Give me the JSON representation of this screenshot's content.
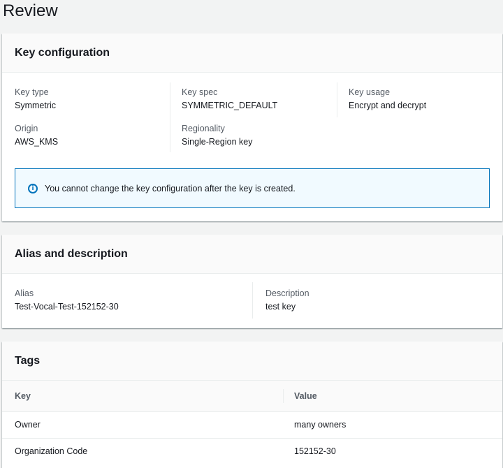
{
  "page": {
    "title": "Review"
  },
  "key_configuration": {
    "header": "Key configuration",
    "fields": {
      "key_type": {
        "label": "Key type",
        "value": "Symmetric"
      },
      "key_spec": {
        "label": "Key spec",
        "value": "SYMMETRIC_DEFAULT"
      },
      "key_usage": {
        "label": "Key usage",
        "value": "Encrypt and decrypt"
      },
      "origin": {
        "label": "Origin",
        "value": "AWS_KMS"
      },
      "regionality": {
        "label": "Regionality",
        "value": "Single-Region key"
      }
    },
    "alert": {
      "icon": "info-icon",
      "text": "You cannot change the key configuration after the key is created."
    }
  },
  "alias_and_description": {
    "header": "Alias and description",
    "alias": {
      "label": "Alias",
      "value": "Test-Vocal-Test-152152-30"
    },
    "description": {
      "label": "Description",
      "value": "test key"
    }
  },
  "tags": {
    "header": "Tags",
    "columns": [
      "Key",
      "Value"
    ],
    "rows": [
      {
        "key": "Owner",
        "value": "many owners"
      },
      {
        "key": "Organization Code",
        "value": "152152-30"
      }
    ]
  },
  "colors": {
    "page_background": "#f2f3f3",
    "info_border": "#0073bb",
    "info_background": "#f1faff"
  }
}
